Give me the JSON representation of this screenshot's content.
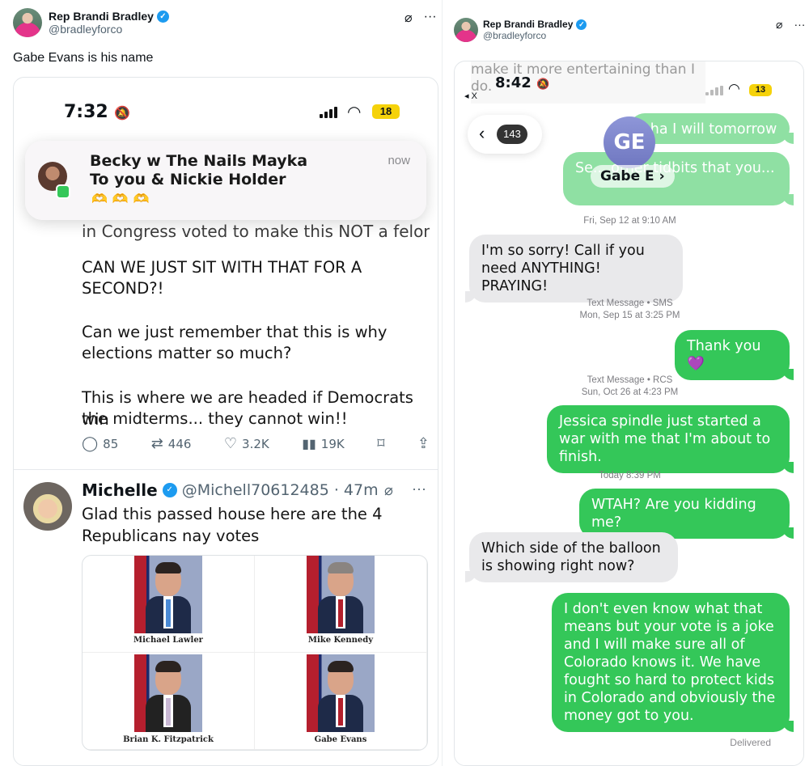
{
  "left": {
    "header": {
      "name": "Rep Brandi Bradley",
      "handle": "@bradleyforco"
    },
    "tweet_text": "Gabe Evans is his name",
    "screenshot": {
      "status": {
        "time": "7:32",
        "battery": "18"
      },
      "notification": {
        "line1": "Becky w The Nails Mayka",
        "line2": "To you & Nickie Holder",
        "time": "now",
        "emojis": "🫶🫶🫶"
      },
      "partial_line": "in Congress voted to make this NOT a felony...",
      "post_lines": [
        "CAN WE JUST SIT WITH THAT FOR A",
        "SECOND?!",
        "Can we just remember that this is why",
        "elections matter so much?",
        "This is where we are headed if Democrats win",
        "the midterms... they cannot win!!"
      ],
      "actions": {
        "replies": "85",
        "reposts": "446",
        "likes": "3.2K",
        "views": "19K"
      },
      "reply": {
        "name": "Michelle",
        "handle": "@Michell70612485 · 47m",
        "text_line1": "Glad this passed house here are the 4",
        "text_line2": "Republicans nay votes",
        "people": [
          {
            "name": "Michael Lawler",
            "tie": "#4a8ad6"
          },
          {
            "name": "Mike Kennedy",
            "tie": "#b3202c"
          },
          {
            "name": "Brian K. Fitzpatrick",
            "tie": "#c9b8d4"
          },
          {
            "name": "Gabe Evans",
            "tie": "#b3202c"
          }
        ]
      }
    }
  },
  "right": {
    "header": {
      "name": "Rep Brandi Bradley",
      "handle": "@bradleyforco"
    },
    "screenshot": {
      "status": {
        "time": "8:42",
        "battery": "13",
        "back_app": "◂ X"
      },
      "faded_top": "make it more entertaining than I do.",
      "back_count": "143",
      "contact": {
        "initials": "GE",
        "name": "Gabe E"
      },
      "obscured_bubbles": [
        "aha I will tomorrow",
        "Se... other tidbits that you..."
      ],
      "messages": [
        {
          "stamp": "Fri, Sep 12 at 9:10 AM"
        },
        {
          "dir": "in",
          "text": "I'm so sorry! Call if you need ANYTHING! PRAYING!"
        },
        {
          "stamp": "Text Message • SMS\nMon, Sep 15 at 3:25 PM"
        },
        {
          "dir": "out",
          "text": "Thank you 💜"
        },
        {
          "stamp": "Text Message • RCS\nSun, Oct 26 at 4:23 PM"
        },
        {
          "dir": "out",
          "text": "Jessica spindle just started a war with me that I'm about to finish."
        },
        {
          "stamp": "Today 8:39 PM"
        },
        {
          "dir": "out",
          "text": "WTAH? Are you kidding me?"
        },
        {
          "dir": "in",
          "text": "Which side of the balloon is showing right now?"
        },
        {
          "dir": "out",
          "text": "I don't even know what that means but your vote is a joke and I will make sure all of Colorado knows it. We have fought so hard to protect kids in Colorado and obviously the money got to you."
        }
      ],
      "delivered": "Delivered"
    }
  }
}
